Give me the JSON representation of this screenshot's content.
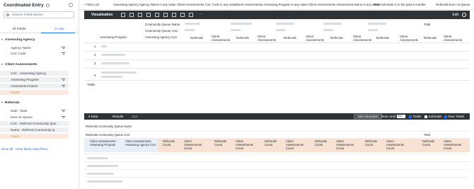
{
  "sidebar": {
    "title": "Coordinated Entry",
    "search_placeholder": "Search Fields Below",
    "tabs": [
      "All Fields",
      "In Use"
    ],
    "groups": [
      {
        "label": "Assessing Agency",
        "fields": [
          "Agency Name",
          "CoC Code"
        ]
      },
      {
        "label": "Client Assessments",
        "fields": [
          "CoC - Assessing Agency",
          "Assessing Program",
          "Assessment Name",
          "Count"
        ]
      },
      {
        "label": "Referrals",
        "fields": [
          "Date - Date",
          "Ever on Queue",
          "CoC - Referral Community Que...",
          "Name - Referral Community Q...",
          "Count"
        ]
      }
    ],
    "links": [
      "Clear all",
      "Clear fields, keep filters"
    ]
  },
  "filterbar": {
    "filters_label": "Filters (6)",
    "filters": [
      "Assessing Agency Agency Name is any value",
      "Client Assessments CoC Code is any value",
      "Client Assessments Assessing Program is any value",
      "Client Assessments Assessment Name is any value",
      "Referrals Date is in the past 6 months",
      "Referrals Ever on Queue"
    ]
  },
  "visualization": {
    "label": "Visualization",
    "edit_label": "Edit",
    "pivot_rows": [
      "Community Queue Name",
      "Community Queue CoC",
      "Assessing Agency CoC"
    ],
    "col_total": "Total",
    "row_header": "Assessing Program",
    "measures": [
      "Referrals",
      "Client Assessments"
    ],
    "row_numbers": [
      "1",
      "2",
      "3",
      "4"
    ],
    "totals_label": "Totals"
  },
  "data_panel": {
    "tabs": [
      "Data",
      "Results",
      "SQL"
    ],
    "add_calc": "Add calculation",
    "row_limit_label": "Row Limit",
    "row_limit_value": "500",
    "toggles": [
      "Totals",
      "Subtotals",
      "Row Totals"
    ],
    "pivot_labels": [
      "Referrals Community Queue Name",
      "Referrals Community Queue CoC"
    ],
    "total_label": "Total",
    "dim_headers": [
      "Client Assessments Assessing Program",
      "Client Assessments Assessing Agency CoC"
    ],
    "measure_headers": [
      "Referrals Count",
      "Client Assessments Count"
    ]
  },
  "colors": {
    "dark_bar": "#2e3338",
    "accent": "#1a73e8",
    "count_highlight": "#fbe9dd"
  }
}
